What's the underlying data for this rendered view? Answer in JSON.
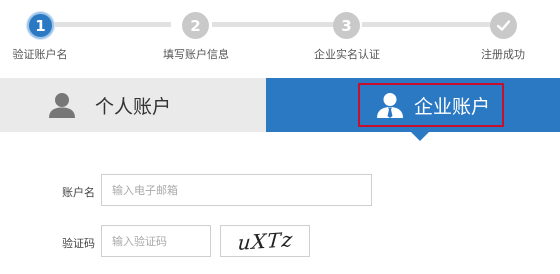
{
  "steps": [
    {
      "number": "1",
      "label": "验证账户名",
      "state": "active"
    },
    {
      "number": "2",
      "label": "填写账户信息",
      "state": "pending"
    },
    {
      "number": "3",
      "label": "企业实名认证",
      "state": "pending"
    },
    {
      "number": "",
      "label": "注册成功",
      "state": "pending",
      "icon": "check-icon"
    }
  ],
  "tabs": {
    "personal": {
      "label": "个人账户",
      "icon": "user-icon",
      "selected": false
    },
    "enterprise": {
      "label": "企业账户",
      "icon": "business-user-icon",
      "selected": true
    }
  },
  "form": {
    "account": {
      "label": "账户名",
      "placeholder": "输入电子邮箱",
      "value": ""
    },
    "captcha": {
      "label": "验证码",
      "placeholder": "输入验证码",
      "value": "",
      "image_text": "uXTz"
    }
  },
  "colors": {
    "accent": "#2b79c2",
    "highlight_border": "#c8102e",
    "inactive": "#c9c9c9"
  }
}
